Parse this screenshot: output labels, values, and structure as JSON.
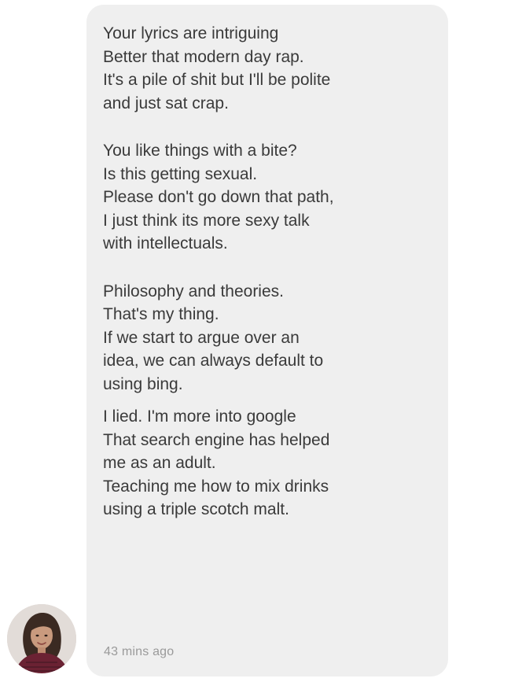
{
  "message": {
    "paragraphs": [
      [
        "Your lyrics are intriguing",
        "Better that modern day rap.",
        "It's a pile of shit but I'll be polite",
        "and just sat crap."
      ],
      [
        "You like things with a bite?",
        "Is this getting sexual.",
        "Please don't go down that path,",
        "I just think its more sexy talk",
        "with intellectuals."
      ],
      [
        "Philosophy and theories.",
        "That's my thing.",
        "If we start to argue over an",
        "idea, we can always default to",
        "using bing."
      ],
      [
        "I lied. I'm more into google",
        "That search engine has helped",
        "me as an adult.",
        "Teaching me how to mix drinks",
        "using a triple scotch malt."
      ]
    ],
    "timestamp": "43 mins ago"
  },
  "sender": {
    "avatar_icon": "profile-photo"
  },
  "colors": {
    "bubble": "#efefef",
    "text": "#3a3a3a",
    "timestamp": "#9a9a9a"
  }
}
